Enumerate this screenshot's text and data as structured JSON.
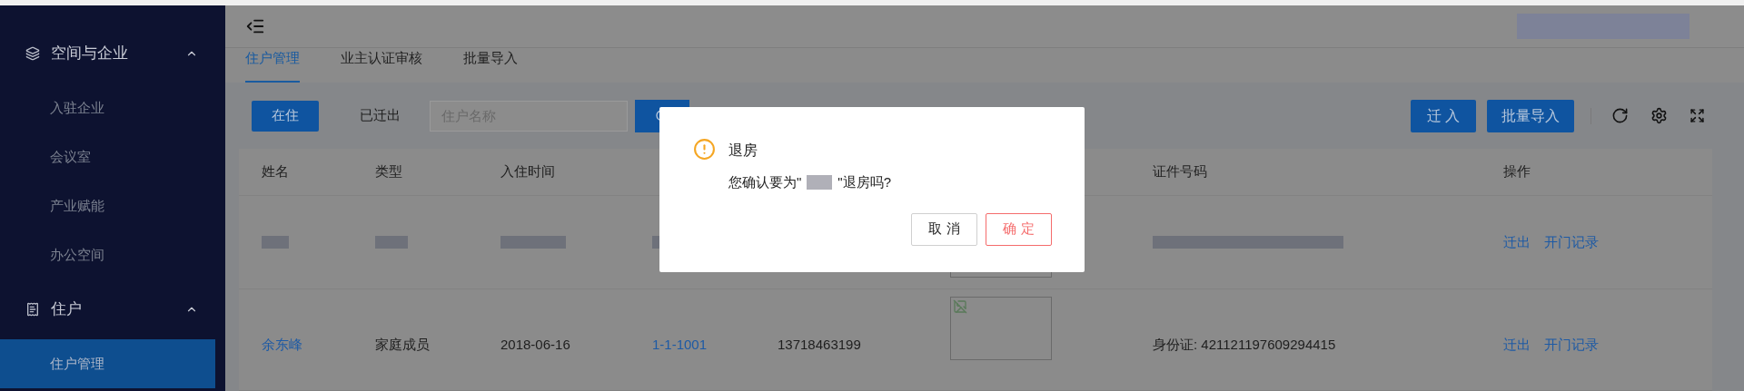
{
  "sidebar": {
    "groups": [
      {
        "label": "空间与企业",
        "expanded": true,
        "items": [
          {
            "label": "入驻企业",
            "selected": false
          },
          {
            "label": "会议室",
            "selected": false
          },
          {
            "label": "产业赋能",
            "selected": false
          },
          {
            "label": "办公空间",
            "selected": false
          }
        ]
      },
      {
        "label": "住户",
        "expanded": true,
        "items": [
          {
            "label": "住户管理",
            "selected": true
          }
        ]
      }
    ]
  },
  "tabs": [
    {
      "label": "住户管理",
      "selected": true
    },
    {
      "label": "业主认证审核",
      "selected": false
    },
    {
      "label": "批量导入",
      "selected": false
    }
  ],
  "filters": [
    {
      "label": "在住",
      "selected": true
    },
    {
      "label": "已迁出",
      "selected": false
    }
  ],
  "search": {
    "placeholder": "住户名称"
  },
  "actions": [
    "迁 入",
    "批量导入"
  ],
  "table": {
    "columns": [
      "姓名",
      "类型",
      "入住时间",
      "证件号码",
      "操作"
    ],
    "rows": [
      {
        "kind": "redacted",
        "actions": [
          "迁出",
          "开门记录"
        ]
      },
      {
        "kind": "record",
        "name": "余东峰",
        "type": "家庭成员",
        "date": "2018-06-16",
        "room": "1-1-1001",
        "phone": "13718463199",
        "id": "身份证: 421121197609294415",
        "actions": [
          "迁出",
          "开门记录"
        ]
      }
    ]
  },
  "dialog": {
    "title": "退房",
    "message_before": "您确认要为\"",
    "message_after": "\"退房吗?",
    "buttons": [
      {
        "label": "取 消",
        "kind": "default"
      },
      {
        "label": "确 定",
        "kind": "danger"
      }
    ]
  }
}
